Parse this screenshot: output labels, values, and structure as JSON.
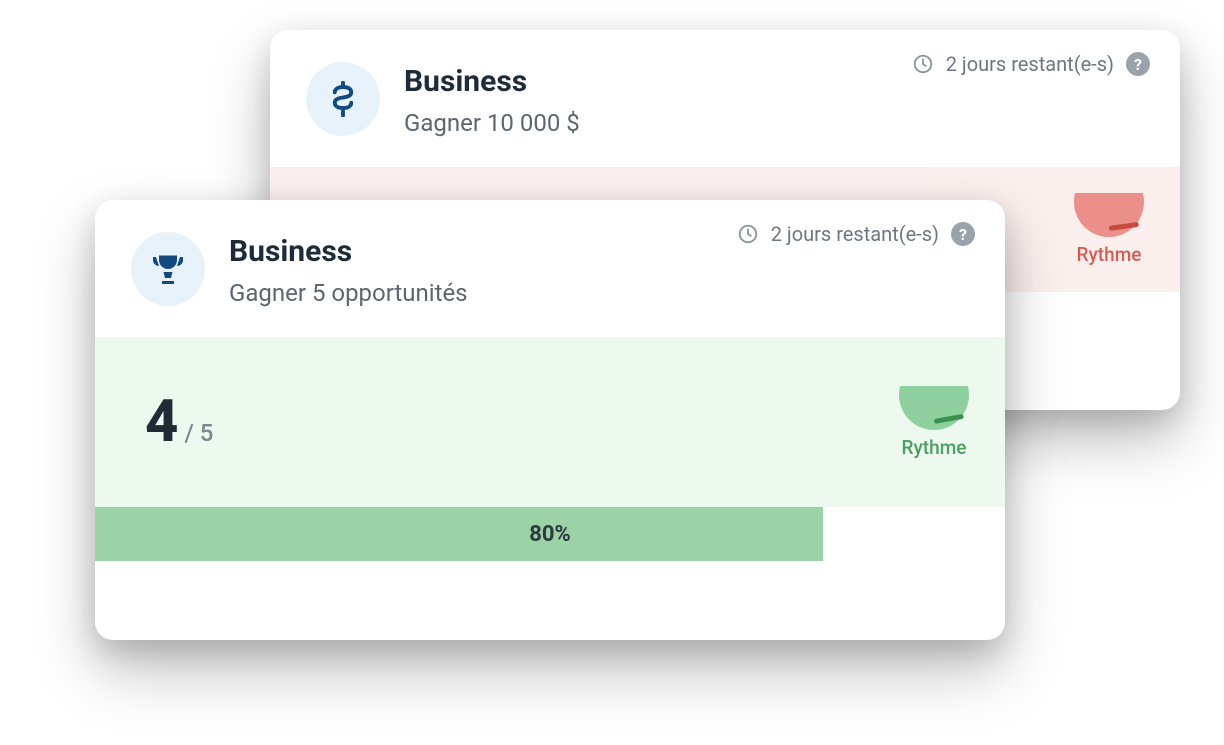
{
  "cards": {
    "back": {
      "title": "Business",
      "subtitle": "Gagner 10 000 $",
      "remaining": "2 jours restant(e-s)",
      "gauge_label": "Rythme"
    },
    "front": {
      "title": "Business",
      "subtitle": "Gagner 5 opportunités",
      "remaining": "2 jours restant(e-s)",
      "metric_main": "4",
      "metric_sub": "/ 5",
      "gauge_label": "Rythme",
      "progress_percent": 80,
      "progress_label": "80%"
    }
  }
}
